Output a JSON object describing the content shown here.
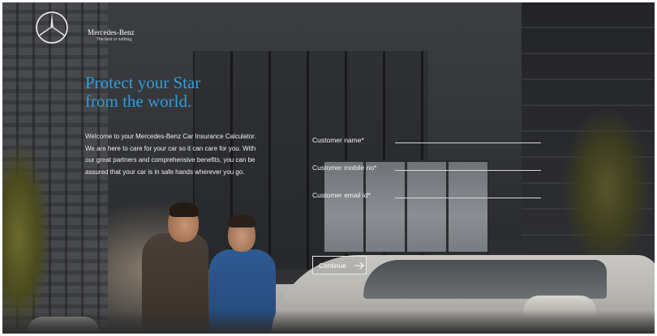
{
  "brand": {
    "logo": "mercedes-star-icon",
    "name": "Mercedes-Benz",
    "tagline": "The best or nothing."
  },
  "hero": {
    "headline": "Protect your Star\nfrom the world.",
    "intro": "Welcome to your Mercedes-Benz Car Insurance Calculator. We are here to care for your car so it can care for you. With our great partners and comprehensive benefits, you can be assured that your car is in safe hands wherever you go."
  },
  "form": {
    "fields": [
      {
        "label": "Customer name*",
        "value": "",
        "placeholder": ""
      },
      {
        "label": "Customer mobile no*",
        "value": "",
        "placeholder": ""
      },
      {
        "label": "Customer email id*",
        "value": "",
        "placeholder": ""
      }
    ],
    "continue_label": "Continue",
    "continue_icon": "arrow-right-icon"
  },
  "colors": {
    "headline": "#2f9ddb",
    "text": "#f2f2f2"
  }
}
